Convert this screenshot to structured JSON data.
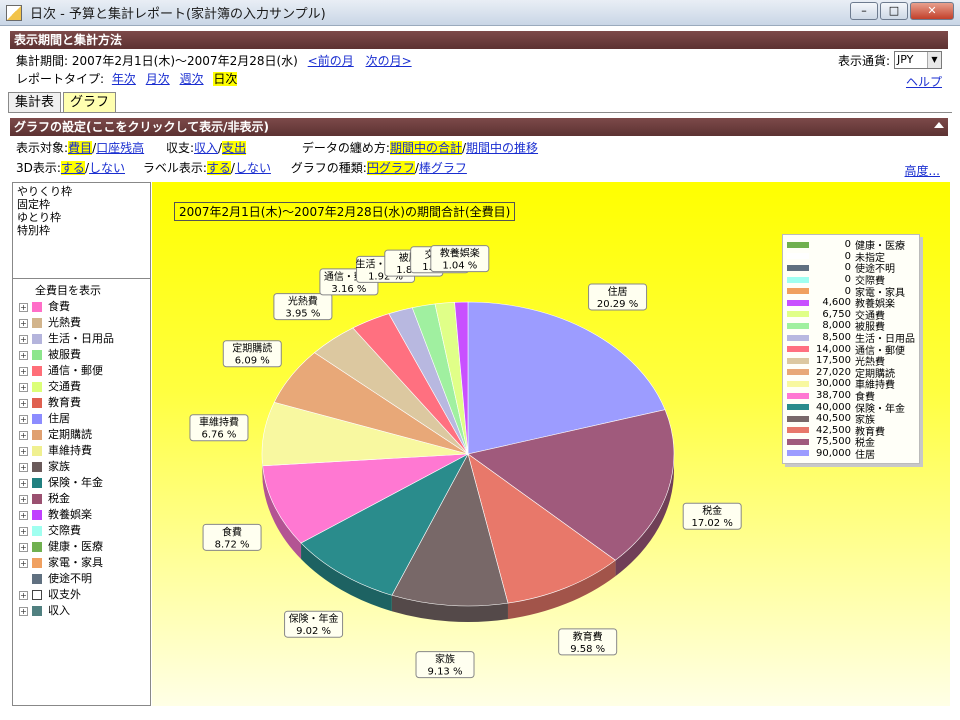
{
  "window": {
    "title": "日次 - 予算と集計レポート(家計簿の入力サンプル)",
    "min": "–",
    "max": "□",
    "close": "✕"
  },
  "period_section": {
    "header": "表示期間と集計方法",
    "period_label": "集計期間: 2007年2月1日(木)〜2007年2月28日(水)",
    "prev_month": "<前の月",
    "next_month": "次の月>",
    "report_type_label": "レポートタイプ:",
    "report_types": [
      "年次",
      "月次",
      "週次",
      "日次"
    ],
    "active_report_type": "日次",
    "currency_label": "表示通貨:",
    "currency_value": "JPY",
    "help": "ヘルプ"
  },
  "tabs": [
    {
      "label": "集計表"
    },
    {
      "label": "グラフ"
    }
  ],
  "graph_settings": {
    "header": "グラフの設定(ここをクリックして表示/非表示)",
    "target_label": "表示対象:",
    "target_opt1": "費目",
    "target_opt2": "口座残高",
    "income_label": "収支:",
    "income_opt1": "収入",
    "income_opt2": "支出",
    "agg_label": "データの纏め方:",
    "agg_opt1": "期間中の合計",
    "agg_opt2": "期間中の推移",
    "threed_label": "3D表示:",
    "threed_on": "する",
    "threed_off": "しない",
    "label_label": "ラベル表示:",
    "label_on": "する",
    "label_off": "しない",
    "gtype_label": "グラフの種類:",
    "gtype_opt1": "円グラフ",
    "gtype_opt2": "棒グラフ",
    "advanced": "高度..."
  },
  "frames": [
    "やりくり枠",
    "固定枠",
    "ゆとり枠",
    "特別枠"
  ],
  "tree": {
    "all_label": "全費目を表示",
    "items": [
      {
        "label": "食費",
        "color": "#ff6ec8"
      },
      {
        "label": "光熱費",
        "color": "#d2b48c"
      },
      {
        "label": "生活・日用品",
        "color": "#b4b4dc"
      },
      {
        "label": "被服費",
        "color": "#8ce68c"
      },
      {
        "label": "通信・郵便",
        "color": "#ff6e78"
      },
      {
        "label": "交通費",
        "color": "#dcff78"
      },
      {
        "label": "教育費",
        "color": "#e06050"
      },
      {
        "label": "住居",
        "color": "#8c8cff"
      },
      {
        "label": "定期購読",
        "color": "#e0a070"
      },
      {
        "label": "車維持費",
        "color": "#f0f090"
      },
      {
        "label": "家族",
        "color": "#6a5a5a"
      },
      {
        "label": "保険・年金",
        "color": "#208080"
      },
      {
        "label": "税金",
        "color": "#9a5070"
      },
      {
        "label": "教養娯楽",
        "color": "#c040ff"
      },
      {
        "label": "交際費",
        "color": "#a0fff0"
      },
      {
        "label": "健康・医療",
        "color": "#70b050"
      },
      {
        "label": "家電・家具",
        "color": "#f0a060"
      },
      {
        "label": "使途不明",
        "color": "#607080"
      },
      {
        "label": "収支外",
        "color": "#ffffff"
      },
      {
        "label": "収入",
        "color": "#508080"
      }
    ]
  },
  "chart_data": {
    "type": "pie",
    "title": "2007年2月1日(木)〜2007年2月28日(水)の期間合計(全費目)",
    "threeD": true,
    "legend_position": "right",
    "slices": [
      {
        "label": "住居",
        "value": 90000,
        "pct": "20.29 %",
        "color": "#9c9cff"
      },
      {
        "label": "税金",
        "value": 75500,
        "pct": "17.02 %",
        "color": "#a05a7c"
      },
      {
        "label": "教育費",
        "value": 42500,
        "pct": "9.58 %",
        "color": "#e8786a"
      },
      {
        "label": "家族",
        "value": 40500,
        "pct": "9.13 %",
        "color": "#786868"
      },
      {
        "label": "保険・年金",
        "value": 40000,
        "pct": "9.02 %",
        "color": "#2a8c8c"
      },
      {
        "label": "食費",
        "value": 38700,
        "pct": "8.72 %",
        "color": "#ff78d2"
      },
      {
        "label": "車維持費",
        "value": 30000,
        "pct": "6.76 %",
        "color": "#f8f8a0"
      },
      {
        "label": "定期購読",
        "value": 27020,
        "pct": "6.09 %",
        "color": "#e8a878"
      },
      {
        "label": "光熱費",
        "value": 17500,
        "pct": "3.95 %",
        "color": "#dcc8a0"
      },
      {
        "label": "通信・郵便",
        "value": 14000,
        "pct": "3.16 %",
        "color": "#ff7080"
      },
      {
        "label": "生活・日用品",
        "value": 8500,
        "pct": "1.92 %",
        "color": "#b8b8e0"
      },
      {
        "label": "被服費",
        "value": 8000,
        "pct": "1.80 %",
        "color": "#a0f0a0"
      },
      {
        "label": "交通費",
        "value": 6750,
        "pct": "1.52 %",
        "color": "#e0ff88"
      },
      {
        "label": "教養娯楽",
        "value": 4600,
        "pct": "1.04 %",
        "color": "#c850ff"
      },
      {
        "label": "家電・家具",
        "value": 0,
        "pct": "",
        "color": "#f0a060"
      },
      {
        "label": "交際費",
        "value": 0,
        "pct": "",
        "color": "#a0fff0"
      },
      {
        "label": "使途不明",
        "value": 0,
        "pct": "",
        "color": "#607080"
      },
      {
        "label": "未指定",
        "value": 0,
        "pct": "",
        "color": "#ffffff"
      },
      {
        "label": "健康・医療",
        "value": 0,
        "pct": "",
        "color": "#70b050"
      }
    ],
    "legend": [
      {
        "value": "0",
        "label": "健康・医療",
        "color": "#70b050"
      },
      {
        "value": "0",
        "label": "未指定",
        "color": "#ffffff"
      },
      {
        "value": "0",
        "label": "使途不明",
        "color": "#607080"
      },
      {
        "value": "0",
        "label": "交際費",
        "color": "#a0fff0"
      },
      {
        "value": "0",
        "label": "家電・家具",
        "color": "#f0a060"
      },
      {
        "value": "4,600",
        "label": "教養娯楽",
        "color": "#c850ff"
      },
      {
        "value": "6,750",
        "label": "交通費",
        "color": "#e0ff88"
      },
      {
        "value": "8,000",
        "label": "被服費",
        "color": "#a0f0a0"
      },
      {
        "value": "8,500",
        "label": "生活・日用品",
        "color": "#b8b8e0"
      },
      {
        "value": "14,000",
        "label": "通信・郵便",
        "color": "#ff7080"
      },
      {
        "value": "17,500",
        "label": "光熱費",
        "color": "#dcc8a0"
      },
      {
        "value": "27,020",
        "label": "定期購読",
        "color": "#e8a878"
      },
      {
        "value": "30,000",
        "label": "車維持費",
        "color": "#f8f8a0"
      },
      {
        "value": "38,700",
        "label": "食費",
        "color": "#ff78d2"
      },
      {
        "value": "40,000",
        "label": "保険・年金",
        "color": "#2a8c8c"
      },
      {
        "value": "40,500",
        "label": "家族",
        "color": "#786868"
      },
      {
        "value": "42,500",
        "label": "教育費",
        "color": "#e8786a"
      },
      {
        "value": "75,500",
        "label": "税金",
        "color": "#a05a7c"
      },
      {
        "value": "90,000",
        "label": "住居",
        "color": "#9c9cff"
      }
    ]
  }
}
